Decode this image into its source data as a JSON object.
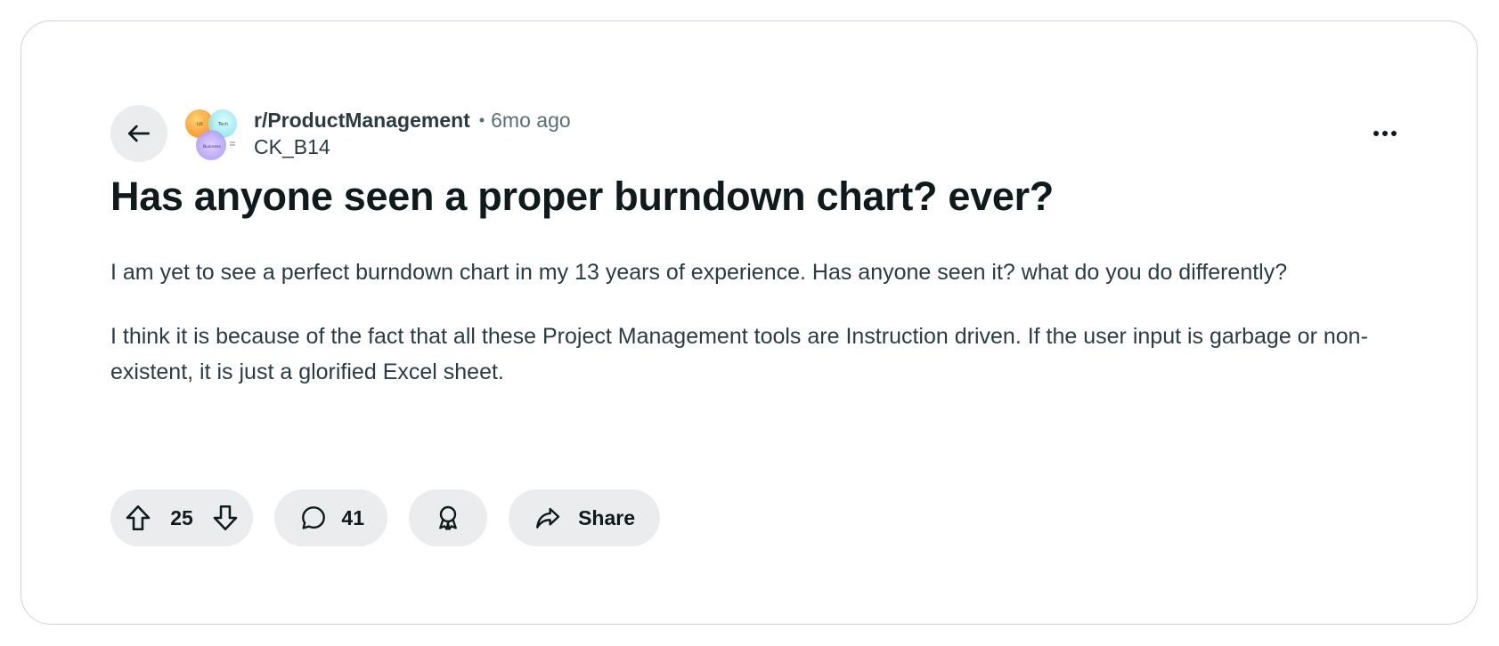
{
  "post": {
    "subreddit": "r/ProductManagement",
    "separator": "•",
    "time_ago": "6mo ago",
    "author": "CK_B14",
    "title": "Has anyone seen a proper burndown chart? ever?",
    "paragraphs": [
      "I am yet to see a perfect burndown chart in my 13 years of experience. Has anyone seen it? what do you do differently?",
      "I think it is because of the fact that all these Project Management tools are Instruction driven. If the user input is garbage or non-existent, it is just a glorified Excel sheet."
    ],
    "avatar_labels": [
      "UX",
      "Tech",
      "Business"
    ]
  },
  "actions": {
    "upvotes": "25",
    "comments": "41",
    "share_label": "Share"
  },
  "icons": {
    "back": "arrow-left-icon",
    "more": "ellipsis-icon",
    "upvote": "arrow-up-outline-icon",
    "downvote": "arrow-down-outline-icon",
    "comment": "speech-bubble-icon",
    "award": "award-ribbon-icon",
    "share": "share-arrow-icon"
  },
  "colors": {
    "pill_bg": "#eaecee",
    "text_primary": "#0f1a1c",
    "text_secondary": "#576f76",
    "card_border": "#cfd0ee"
  }
}
